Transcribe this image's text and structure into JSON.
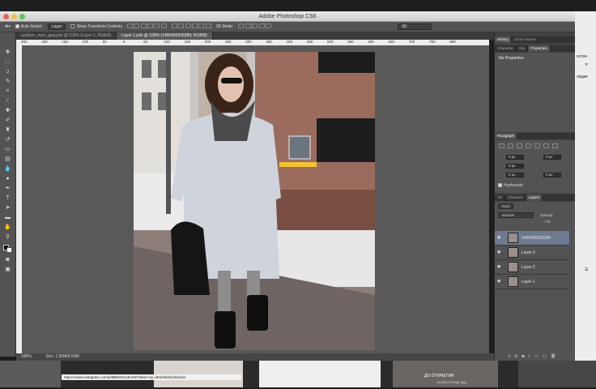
{
  "app": {
    "title": "Adobe Photoshop CS6",
    "zoom": "100%",
    "doc_info": "Doc: 1,50M/8,50M"
  },
  "options_bar": {
    "auto_select_label": "Auto-Select:",
    "auto_select_target": "Layer",
    "show_transform_label": "Show Transform Controls",
    "mode_3d": "3D Mode:",
    "workspace": "3D"
  },
  "doc_tabs": [
    {
      "label": "шаблон_пукз_дид.psd @ 100% (Layer 1, RGB/8)"
    },
    {
      "label": "Layer 1.psb @ 100% (1455456258389, RGB/8)"
    }
  ],
  "ruler_ticks": [
    "250",
    "200",
    "150",
    "100",
    "50",
    "0",
    "50",
    "100",
    "150",
    "200",
    "250",
    "300",
    "350",
    "400",
    "450",
    "500",
    "550",
    "600",
    "650",
    "700",
    "750",
    "800"
  ],
  "panels": {
    "top_tabs": [
      "History",
      "Clone Source"
    ],
    "props_tabs": [
      "Character",
      "Info",
      "Properties"
    ],
    "props_text": "No Properties",
    "paragraph_title": "Paragraph",
    "para_fields": [
      "0 px",
      "0 px",
      "0 px",
      "0 px",
      "0 px"
    ],
    "hyphenate": "Hyphenate",
    "layers_tabs": [
      "3D",
      "Channels",
      "Layers"
    ],
    "kind": "Kind",
    "blend_mode": "Normal",
    "opacity_label": "Opacity:",
    "fill_label": "Fill:",
    "layers": [
      {
        "name": "1455456258389",
        "selected": true
      },
      {
        "name": "Layer 3",
        "selected": false
      },
      {
        "name": "Layer 2",
        "selected": false
      },
      {
        "name": "Layer 1",
        "selected": false
      }
    ]
  },
  "overlay_text": {
    "url": "https://www.instagram.com/p/BBh8OzwtLVM/?taken-by=streetfashionkazan",
    "strip_caption": "ДО ОТКРЫТИЯ",
    "strip_file": "product-image.jpg",
    "side_1": "остен",
    "side_2": "ладки"
  },
  "colors": {
    "accent": "#6d7a90",
    "panel_bg": "#535353",
    "canvas_bg": "#595959"
  }
}
